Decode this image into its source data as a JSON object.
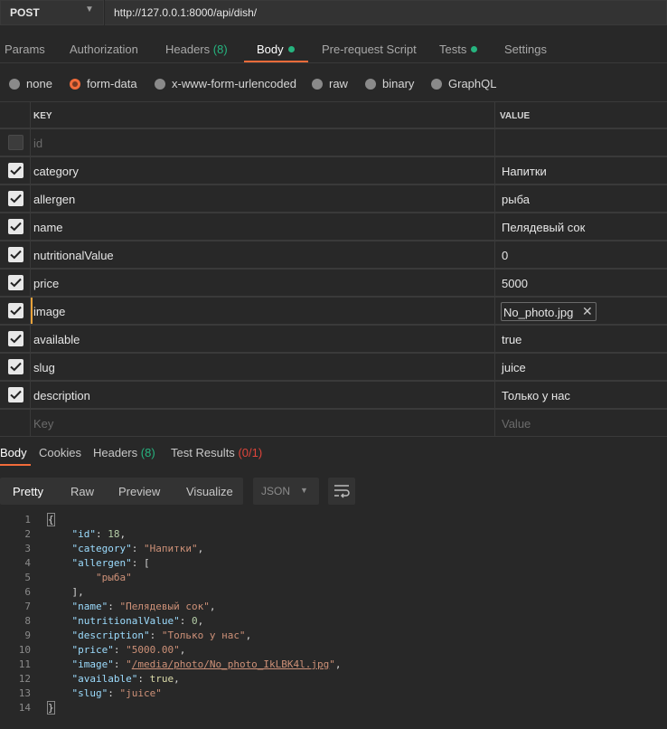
{
  "request": {
    "method": "POST",
    "url": "http://127.0.0.1:8000/api/dish/"
  },
  "request_tabs": [
    {
      "label": "Params"
    },
    {
      "label": "Authorization"
    },
    {
      "label": "Headers",
      "count": "(8)"
    },
    {
      "label": "Body",
      "active": true,
      "dot": true
    },
    {
      "label": "Pre-request Script"
    },
    {
      "label": "Tests",
      "dot": true
    },
    {
      "label": "Settings"
    }
  ],
  "body_types": [
    {
      "label": "none"
    },
    {
      "label": "form-data",
      "selected": true
    },
    {
      "label": "x-www-form-urlencoded"
    },
    {
      "label": "raw"
    },
    {
      "label": "binary"
    },
    {
      "label": "GraphQL"
    }
  ],
  "params_table": {
    "key_header": "KEY",
    "value_header": "VALUE",
    "rows": [
      {
        "checked": false,
        "key": "id",
        "value": ""
      },
      {
        "checked": true,
        "key": "category",
        "value": "Напитки"
      },
      {
        "checked": true,
        "key": "allergen",
        "value": "рыба"
      },
      {
        "checked": true,
        "key": "name",
        "value": "Пелядевый сок"
      },
      {
        "checked": true,
        "key": "nutritionalValue",
        "value": "0"
      },
      {
        "checked": true,
        "key": "price",
        "value": "5000"
      },
      {
        "checked": true,
        "key": "image",
        "value": "No_photo.jpg",
        "is_file": true
      },
      {
        "checked": true,
        "key": "available",
        "value": "true"
      },
      {
        "checked": true,
        "key": "slug",
        "value": "juice"
      },
      {
        "checked": true,
        "key": "description",
        "value": "Только у нас"
      }
    ],
    "key_placeholder": "Key",
    "value_placeholder": "Value"
  },
  "response_tabs": [
    {
      "label": "Body",
      "active": true
    },
    {
      "label": "Cookies"
    },
    {
      "label": "Headers",
      "count": "(8)"
    },
    {
      "label": "Test Results",
      "count": "(0/1)"
    }
  ],
  "response_view": {
    "modes": [
      "Pretty",
      "Raw",
      "Preview",
      "Visualize"
    ],
    "active_mode": "Pretty",
    "format": "JSON"
  },
  "response_body": {
    "line_numbers": [
      "1",
      "2",
      "3",
      "4",
      "5",
      "6",
      "7",
      "8",
      "9",
      "10",
      "11",
      "12",
      "13",
      "14"
    ],
    "id": "18",
    "category": "\"Напитки\"",
    "allergen_item": "\"рыба\"",
    "name": "\"Пелядевый сок\"",
    "nutritionalValue": "0",
    "description": "\"Только у нас\"",
    "price": "\"5000.00\"",
    "image": "/media/photo/No_photo_IkLBK4l.jpg",
    "available": "true",
    "slug": "\"juice\""
  },
  "colors": {
    "accent": "#f26b3a",
    "success": "#26b47f",
    "error": "#e0453b",
    "background": "#282828"
  }
}
